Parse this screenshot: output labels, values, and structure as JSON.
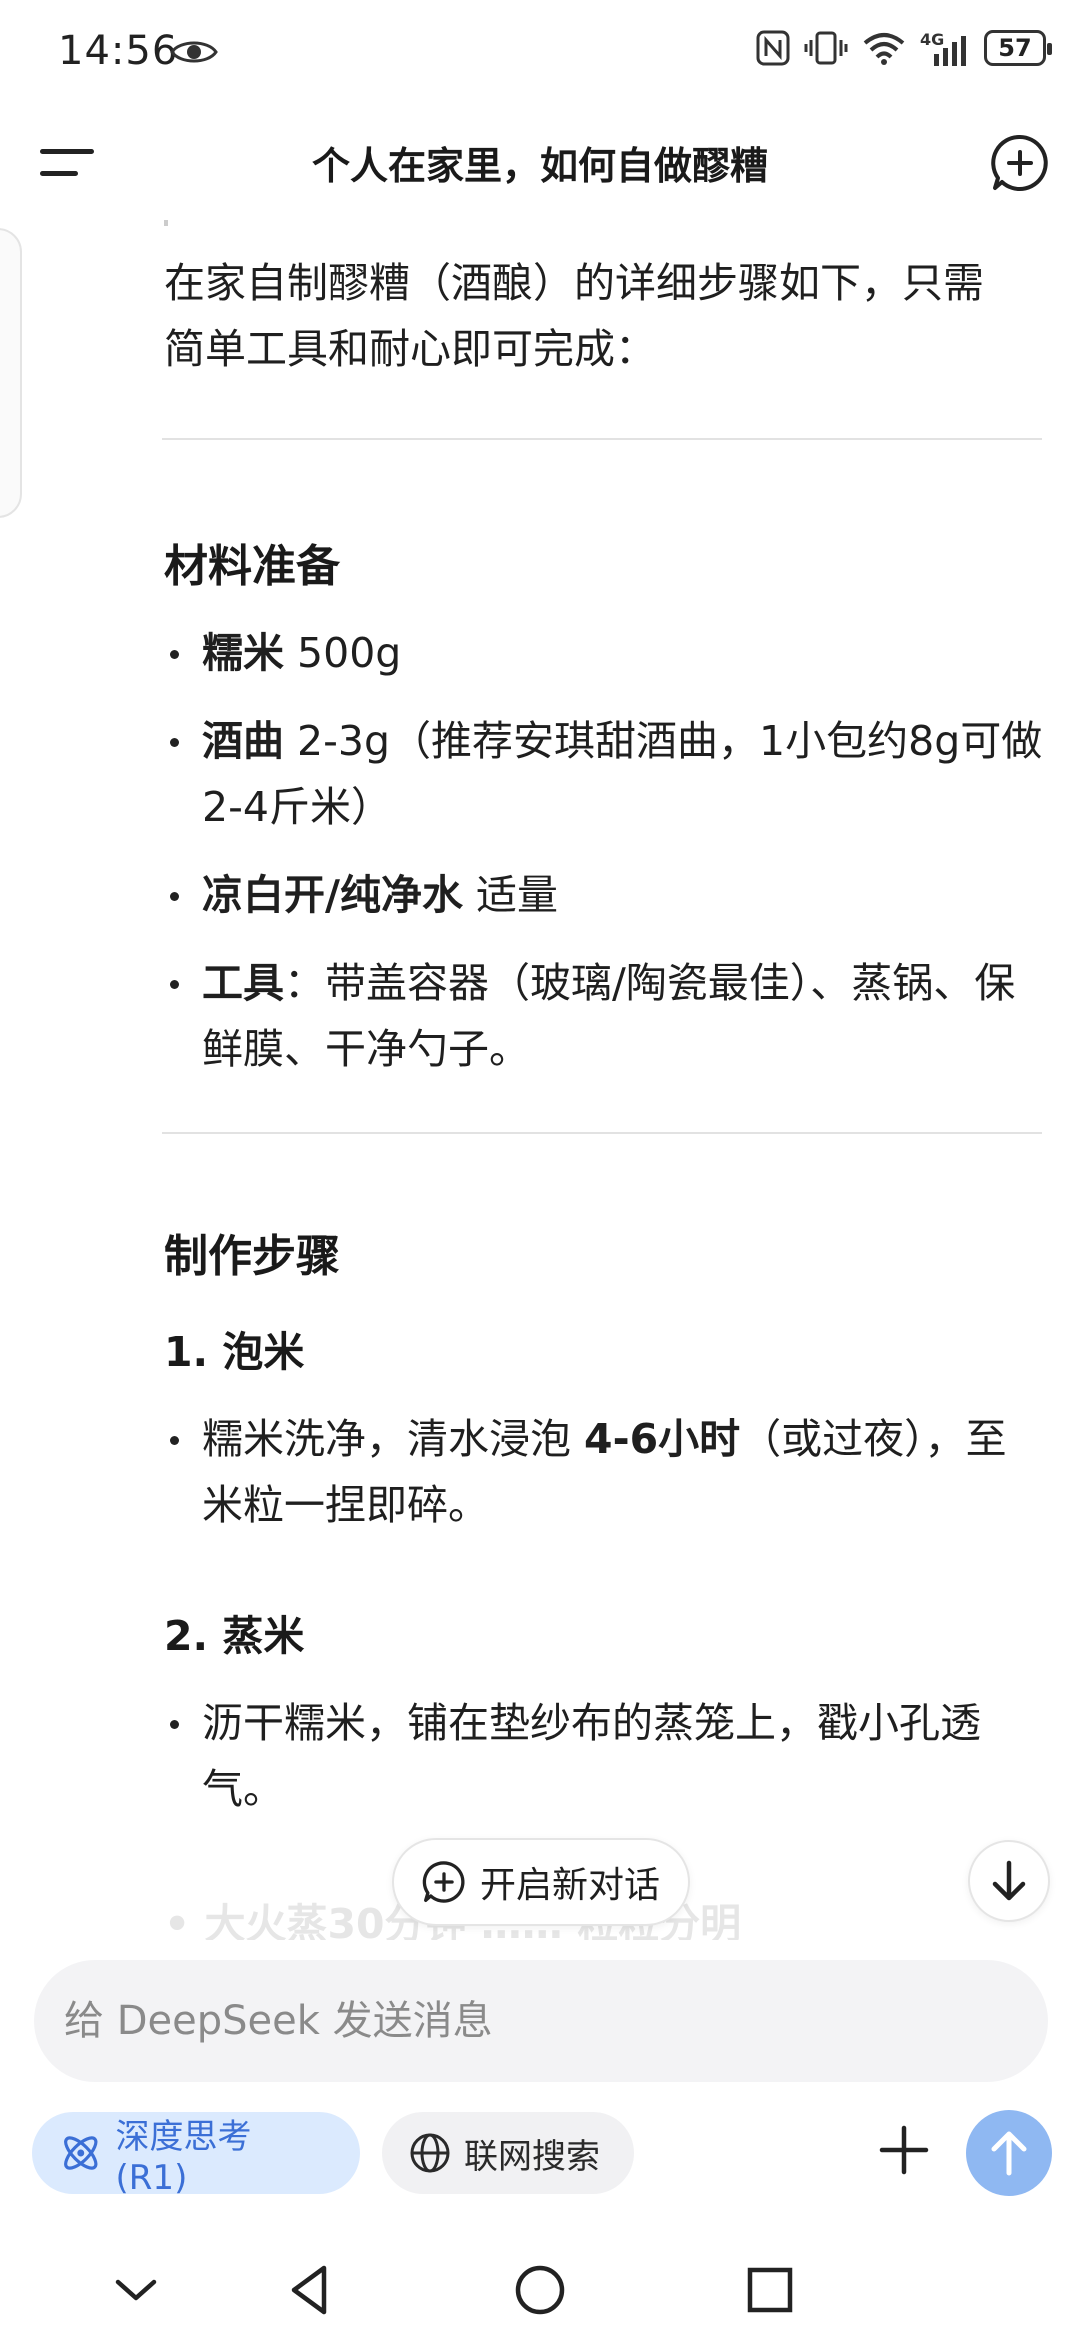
{
  "status_bar": {
    "time": "14:56",
    "network": "4G",
    "battery": "57"
  },
  "header": {
    "title": "个人在家里，如何自做醪糟"
  },
  "message": {
    "intro": "在家自制醪糟（酒酿）的详细步骤如下，只需简单工具和耐心即可完成：",
    "materials": {
      "heading": "材料准备",
      "items": [
        {
          "bold": "糯米",
          "text": " 500g"
        },
        {
          "bold": "酒曲",
          "text": " 2-3g（推荐安琪甜酒曲，1小包约8g可做2-4斤米）"
        },
        {
          "bold": "凉白开/纯净水",
          "text": " 适量"
        },
        {
          "bold": "工具",
          "text": "：带盖容器（玻璃/陶瓷最佳）、蒸锅、保鲜膜、干净勺子。"
        }
      ]
    },
    "steps": {
      "heading": "制作步骤",
      "step1": {
        "title": "1. 泡米",
        "pre": "糯米洗净，清水浸泡 ",
        "bold": "4-6小时",
        "post": "（或过夜），至米粒一捏即碎。"
      },
      "step2": {
        "title": "2. 蒸米",
        "text": "沥干糯米，铺在垫纱布的蒸笼上，戳小孔透气。"
      },
      "faded_next": "• 大火蒸30分钟 …… 粒粒分明"
    }
  },
  "floating": {
    "new_dialog_label": "开启新对话"
  },
  "composer": {
    "placeholder": "给 DeepSeek 发送消息",
    "value": ""
  },
  "chips": {
    "deep_think": "深度思考 (R1)",
    "web_search": "联网搜索"
  },
  "colors": {
    "accent": "#3b6fd6",
    "chip_active_bg": "#dbeafe",
    "send_button": "#8fb8f2"
  }
}
